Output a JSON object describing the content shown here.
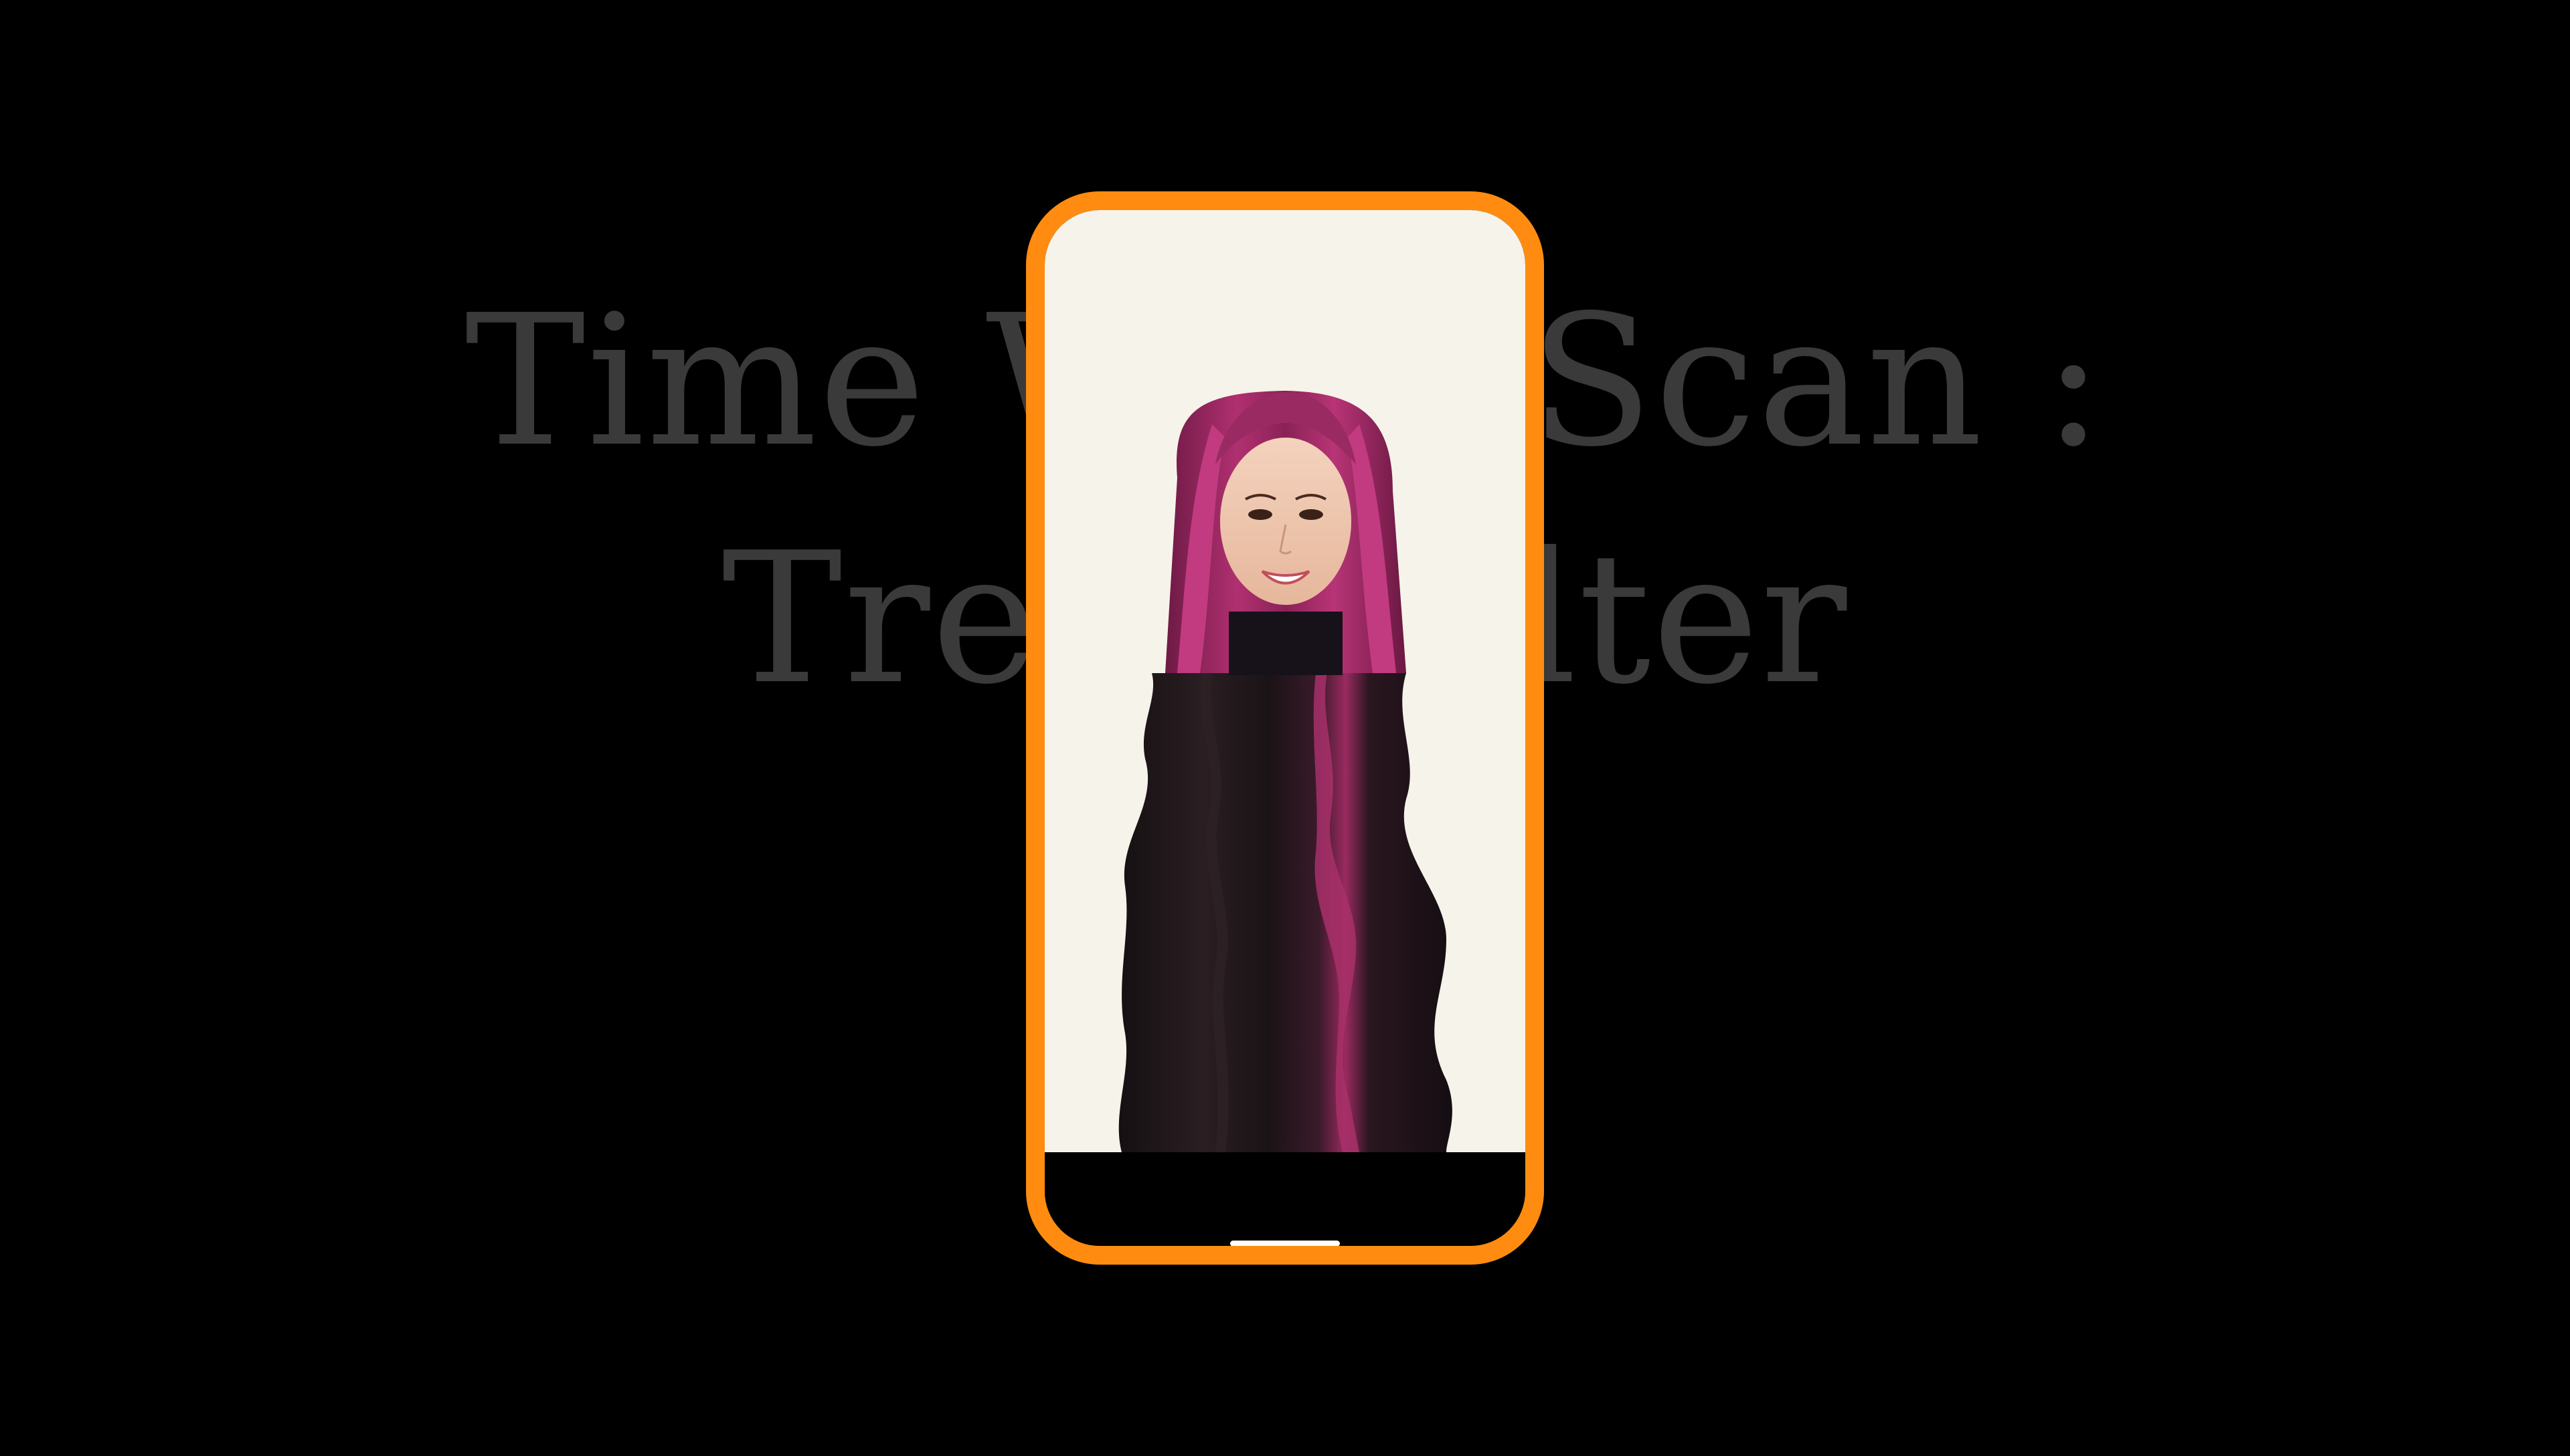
{
  "background": {
    "title_line1": "Time Warp Scan :",
    "title_line2": "Trend Filter",
    "color": "#000000",
    "title_color": "#3a3a3a"
  },
  "phone": {
    "frame_color": "#ff8c10",
    "screen_color": "#f6f3ea",
    "photo": {
      "subject": "smiling woman with magenta hair",
      "effect": "time-warp wavy stretch below face",
      "hair_color": "#a0285e"
    },
    "home_indicator_icon": "home-indicator-bar"
  }
}
